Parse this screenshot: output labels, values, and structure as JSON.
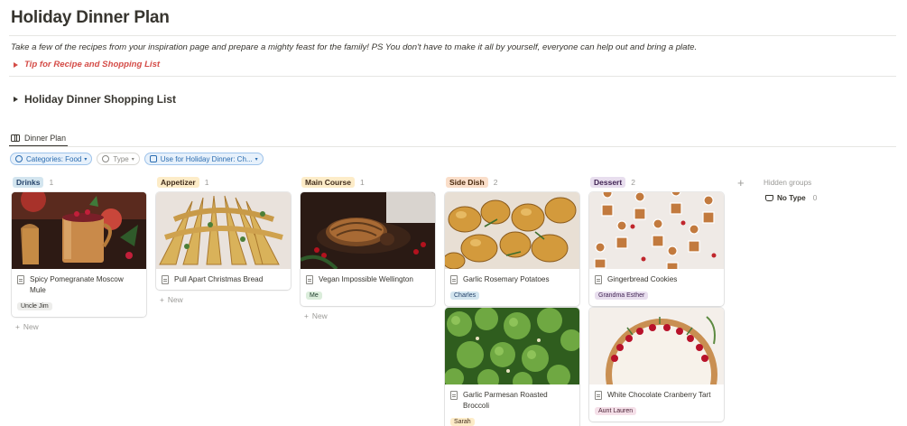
{
  "page": {
    "title": "Holiday Dinner Plan",
    "description": "Take a few of the recipes from your inspiration page and prepare a mighty feast for the family! PS You don't have to make it all by yourself, everyone can help out and bring a plate.",
    "tip_toggle": "Tip for Recipe and Shopping List",
    "shopping_toggle": "Holiday Dinner Shopping List"
  },
  "view": {
    "tab_label": "Dinner Plan"
  },
  "filters": [
    {
      "label": "Categories: Food",
      "style": "active"
    },
    {
      "label": "Type",
      "style": "inactive"
    },
    {
      "label": "Use for Holiday Dinner: Ch...",
      "style": "active"
    }
  ],
  "board": {
    "new_label": "New",
    "hidden_groups_label": "Hidden groups",
    "hidden_no_type": {
      "label": "No Type",
      "count": "0"
    },
    "columns": [
      {
        "name": "Drinks",
        "count": "1",
        "tag_bg": "#d3e5ef",
        "tag_fg": "#28456c",
        "cards": [
          {
            "title": "Spicy Pomegranate Moscow Mule",
            "person": "Uncle Jim",
            "person_bg": "#ededeb",
            "person_fg": "#32302c"
          }
        ]
      },
      {
        "name": "Appetizer",
        "count": "1",
        "tag_bg": "#fdecc8",
        "tag_fg": "#402c1b",
        "cards": [
          {
            "title": "Pull Apart Christmas Bread",
            "person": "",
            "person_bg": "",
            "person_fg": ""
          }
        ]
      },
      {
        "name": "Main Course",
        "count": "1",
        "tag_bg": "#fdecc8",
        "tag_fg": "#402c1b",
        "cards": [
          {
            "title": "Vegan Impossible Wellington",
            "person": "Me",
            "person_bg": "#dbeddb",
            "person_fg": "#1c3829"
          }
        ]
      },
      {
        "name": "Side Dish",
        "count": "2",
        "tag_bg": "#fadec9",
        "tag_fg": "#49290e",
        "cards": [
          {
            "title": "Garlic Rosemary Potatoes",
            "person": "Charles",
            "person_bg": "#d3e5ef",
            "person_fg": "#28456c"
          },
          {
            "title": "Garlic Parmesan Roasted Broccoli",
            "person": "Sarah",
            "person_bg": "#fdecc8",
            "person_fg": "#402c1b"
          }
        ]
      },
      {
        "name": "Dessert",
        "count": "2",
        "tag_bg": "#e8deee",
        "tag_fg": "#412454",
        "cards": [
          {
            "title": "Gingerbread Cookies",
            "person": "Grandma Esther",
            "person_bg": "#e8deee",
            "person_fg": "#412454"
          },
          {
            "title": "White Chocolate Cranberry Tart",
            "person": "Aunt Lauren",
            "person_bg": "#f5e0e9",
            "person_fg": "#4c2337"
          }
        ]
      }
    ]
  }
}
